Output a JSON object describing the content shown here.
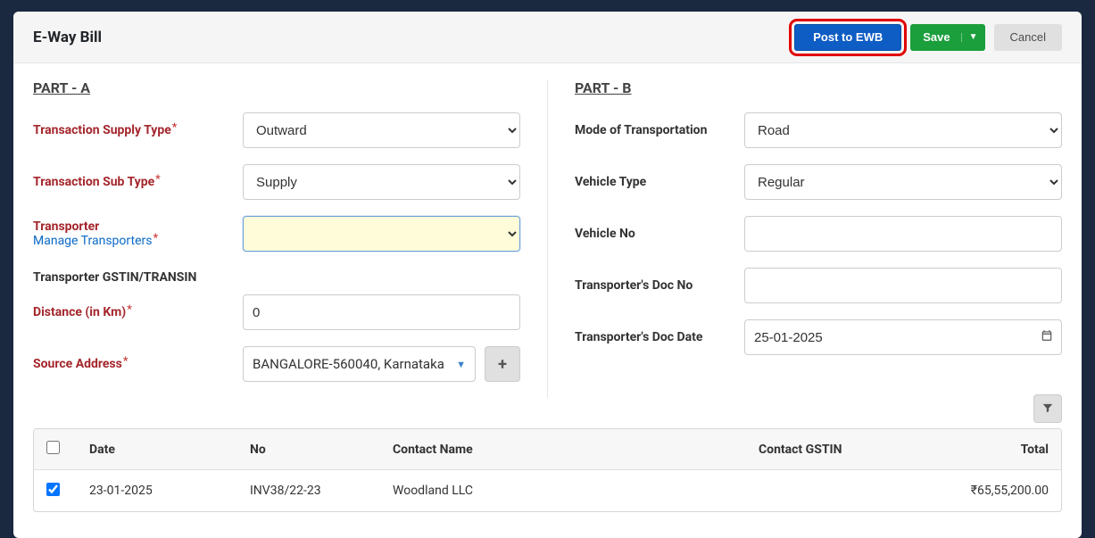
{
  "header": {
    "title": "E-Way Bill",
    "postLabel": "Post to EWB",
    "saveLabel": "Save",
    "cancelLabel": "Cancel"
  },
  "partA": {
    "heading": "PART - A",
    "labels": {
      "supplyType": "Transaction Supply Type",
      "subType": "Transaction Sub Type",
      "transporter": "Transporter",
      "manageTransporters": "Manage Transporters",
      "gstin": "Transporter GSTIN/TRANSIN",
      "distance": "Distance (in Km)",
      "sourceAddress": "Source Address"
    },
    "values": {
      "supplyType": "Outward",
      "subType": "Supply",
      "transporter": "",
      "distance": "0",
      "sourceAddress": "BANGALORE-560040, Karnataka"
    }
  },
  "partB": {
    "heading": "PART - B",
    "labels": {
      "mode": "Mode of Transportation",
      "vehicleType": "Vehicle Type",
      "vehicleNo": "Vehicle No",
      "docNo": "Transporter's Doc No",
      "docDate": "Transporter's Doc Date"
    },
    "values": {
      "mode": "Road",
      "vehicleType": "Regular",
      "vehicleNo": "",
      "docNo": "",
      "docDate": "25-01-2025"
    }
  },
  "table": {
    "headers": {
      "date": "Date",
      "no": "No",
      "contactName": "Contact Name",
      "contactGstin": "Contact GSTIN",
      "total": "Total"
    },
    "rows": [
      {
        "checked": true,
        "date": "23-01-2025",
        "no": "INV38/22-23",
        "contactName": "Woodland LLC",
        "contactGstin": "",
        "total": "₹65,55,200.00"
      }
    ]
  }
}
